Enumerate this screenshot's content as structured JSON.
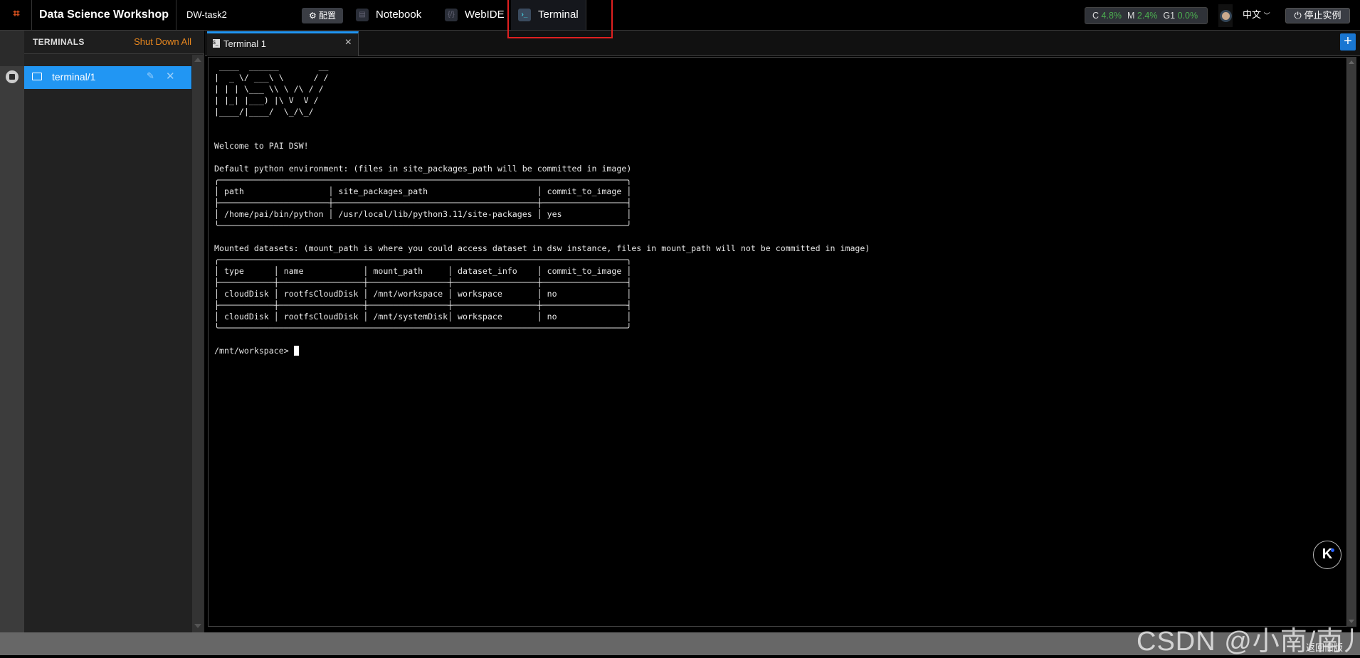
{
  "header": {
    "logo": "logo-icon",
    "title": "Data Science Workshop",
    "instance": "DW-task2",
    "config_label": "配置",
    "nav_tabs": [
      {
        "label": "Notebook",
        "icon": "notebook-icon"
      },
      {
        "label": "WebIDE",
        "icon": "code-icon"
      },
      {
        "label": "Terminal",
        "icon": "terminal-icon",
        "active": true
      }
    ],
    "stats": {
      "c_label": "C",
      "c_value": "4.8%",
      "m_label": "M",
      "m_value": "2.4%",
      "g_label": "G1",
      "g_value": "0.0%"
    },
    "language": "中文",
    "stop_label": "停止实例",
    "highlight_color": "#e02020"
  },
  "sidebar": {
    "title": "TERMINALS",
    "shutdown_label": "Shut Down All",
    "items": [
      {
        "label": "terminal/1",
        "selected": true
      }
    ]
  },
  "tabs": [
    {
      "label": "Terminal 1",
      "active": true
    }
  ],
  "colors": {
    "accent": "#2196f3",
    "shutdown": "#e8871e",
    "stat_value": "#4caf50"
  },
  "terminal": {
    "logo_art": [
      " ____  ______        __",
      "|  _ \\/ ___\\ \\      / /",
      "| | | \\___ \\\\ \\ /\\ / /",
      "| |_| |___) |\\ V  V /",
      "|____/|____/  \\_/\\_/"
    ],
    "welcome": "Welcome to PAI DSW!",
    "env_caption": "Default python environment: (files in site_packages_path will be committed in image)",
    "env_table": {
      "headers": [
        "path",
        "site_packages_path",
        "commit_to_image"
      ],
      "rows": [
        [
          "/home/pai/bin/python",
          "/usr/local/lib/python3.11/site-packages",
          "yes"
        ]
      ]
    },
    "mount_caption": "Mounted datasets: (mount_path is where you could access dataset in dsw instance, files in mount_path will not be committed in image)",
    "mount_table": {
      "headers": [
        "type",
        "name",
        "mount_path",
        "dataset_info",
        "commit_to_image"
      ],
      "rows": [
        [
          "cloudDisk",
          "rootfsCloudDisk",
          "/mnt/workspace",
          "workspace",
          "no"
        ],
        [
          "cloudDisk",
          "rootfsCloudDisk",
          "/mnt/systemDisk",
          "workspace",
          "no"
        ]
      ]
    },
    "prompt": "/mnt/workspace> "
  },
  "footer": {
    "old_version": "返回旧版",
    "watermark": "CSDN @小南/南儿"
  }
}
